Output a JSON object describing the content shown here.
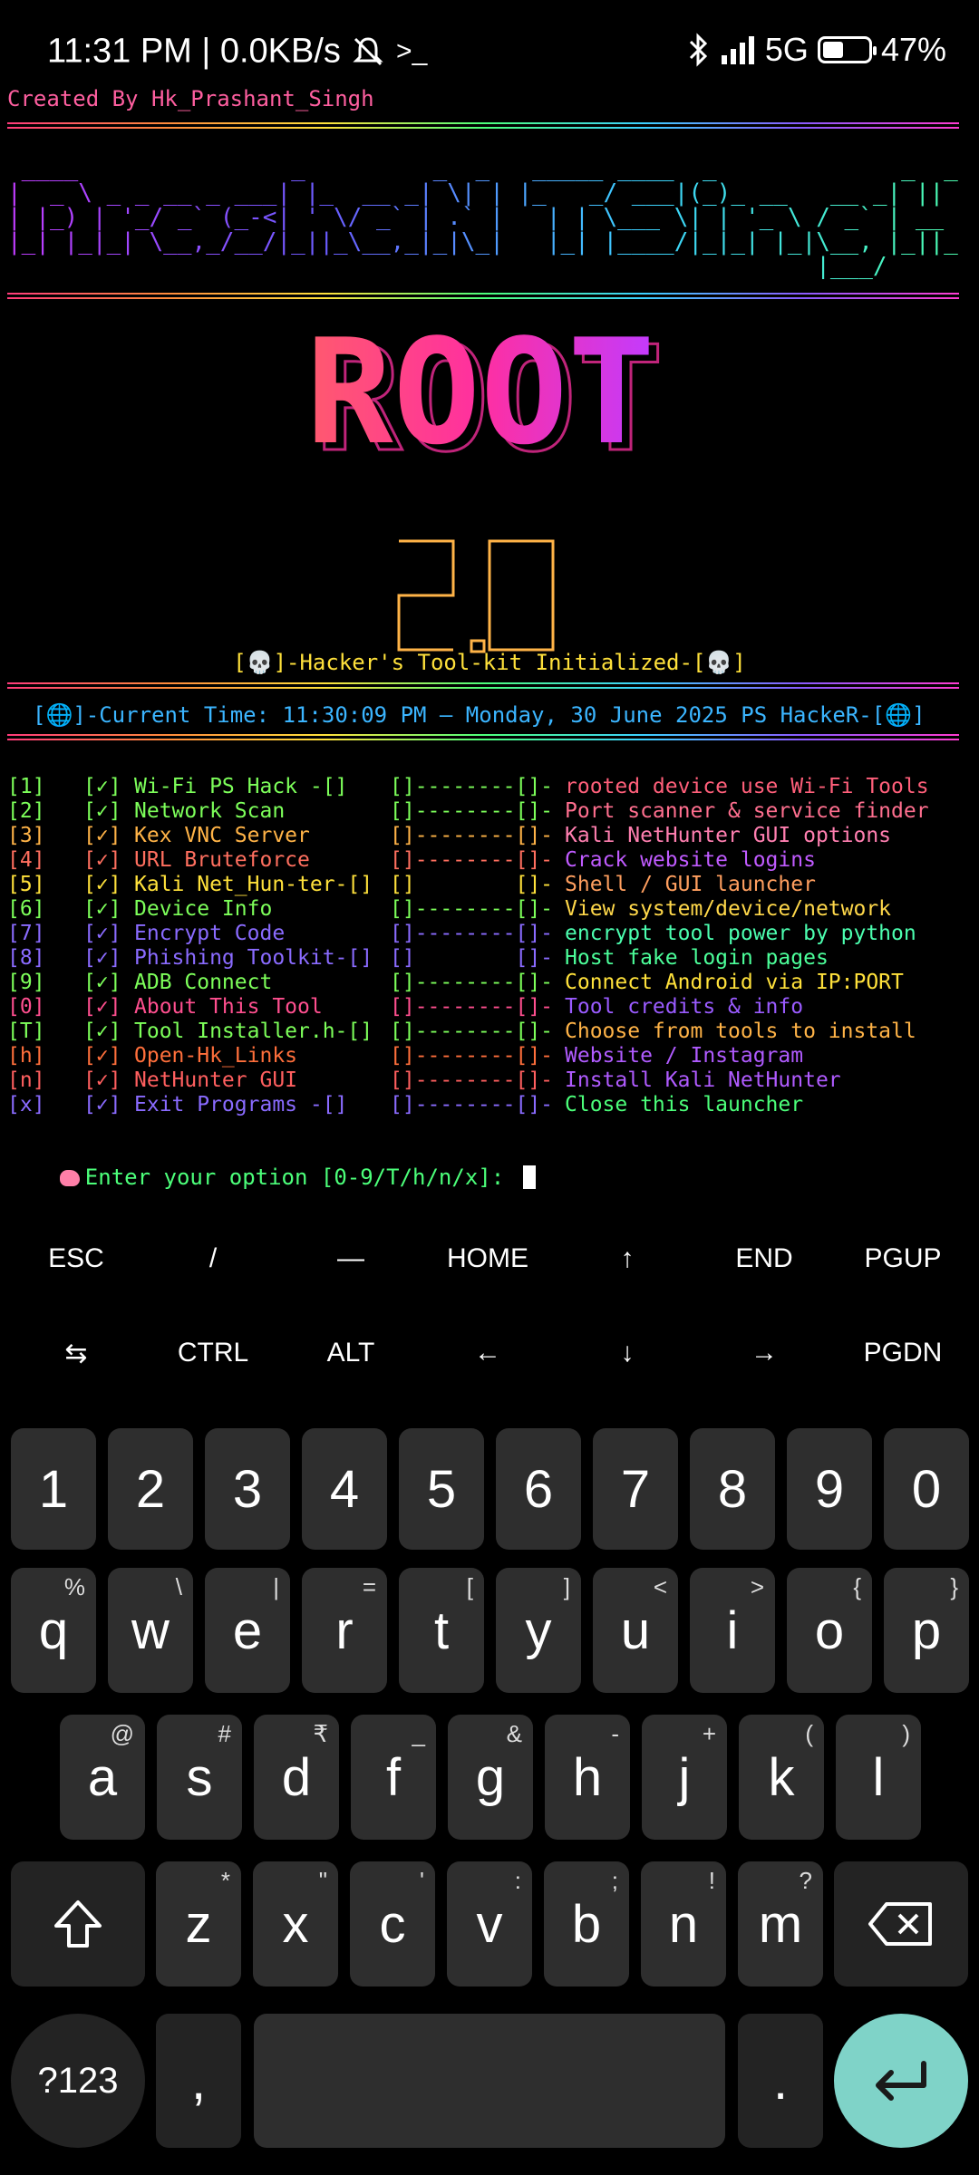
{
  "status": {
    "time": "11:31 PM",
    "speed": "0.0KB/s",
    "network": "5G",
    "battery": "47%",
    "battery_level": 0.47
  },
  "terminal": {
    "credit": "Created By Hk_Prashant_Singh",
    "root_title": "ROOT",
    "init_line": "[💀]-Hacker's Tool-kit Initialized-[💀]",
    "time_line": "[🌐]-Current Time: 11:30:09 PM — Monday, 30 June 2025 PS HackeR-[🌐]",
    "menu": [
      {
        "key": "[1]",
        "check": "[✓]",
        "name": "Wi-Fi PS Hack -[]",
        "dash": "[]--------[]-",
        "desc": "rooted device use Wi-Fi Tools",
        "color": "#7dff5a",
        "desc_color": "#ff5f7a"
      },
      {
        "key": "[2]",
        "check": "[✓]",
        "name": "Network Scan",
        "dash": "[]--------[]-",
        "desc": "Port scanner & service finder",
        "color": "#7dff5a",
        "desc_color": "#ff6f8f"
      },
      {
        "key": "[3]",
        "check": "[✓]",
        "name": "Kex VNC Server",
        "dash": "[]--------[]-",
        "desc": "Kali NetHunter GUI options",
        "color": "#ffb347",
        "desc_color": "#ff7fb0"
      },
      {
        "key": "[4]",
        "check": "[✓]",
        "name": "URL Bruteforce",
        "dash": "[]--------[]-",
        "desc": "Crack website logins",
        "color": "#ff6f5f",
        "desc_color": "#c05bff"
      },
      {
        "key": "[5]",
        "check": "[✓]",
        "name": "Kali Net_Hun-ter-[]",
        "dash": "[]        []-",
        "desc": "Shell / GUI launcher",
        "color": "#ffe13b",
        "desc_color": "#ff9f5f"
      },
      {
        "key": "[6]",
        "check": "[✓]",
        "name": "Device Info",
        "dash": "[]--------[]-",
        "desc": "View system/device/network",
        "color": "#7dff5a",
        "desc_color": "#ffd84a"
      },
      {
        "key": "[7]",
        "check": "[✓]",
        "name": "Encrypt Code",
        "dash": "[]--------[]-",
        "desc": "encrypt tool power by python",
        "color": "#8a6bff",
        "desc_color": "#4cffb0"
      },
      {
        "key": "[8]",
        "check": "[✓]",
        "name": "Phishing Toolkit-[]",
        "dash": "[]        []-",
        "desc": "Host fake login pages",
        "color": "#8a6bff",
        "desc_color": "#4cff9a"
      },
      {
        "key": "[9]",
        "check": "[✓]",
        "name": "ADB Connect",
        "dash": "[]--------[]-",
        "desc": "Connect Android via IP:PORT",
        "color": "#7dff5a",
        "desc_color": "#ffe13b"
      },
      {
        "key": "[0]",
        "check": "[✓]",
        "name": "About This Tool",
        "dash": "[]--------[]-",
        "desc": "Tool credits & info",
        "color": "#ff4f8f",
        "desc_color": "#9a5bff"
      },
      {
        "key": "[T]",
        "check": "[✓]",
        "name": "Tool Installer.h-[]",
        "dash": "[]--------[]-",
        "desc": "Choose from tools to install",
        "color": "#7dff5a",
        "desc_color": "#ffb347"
      },
      {
        "key": "[h]",
        "check": "[✓]",
        "name": "Open-Hk_Links",
        "dash": "[]--------[]-",
        "desc": "Website / Instagram",
        "color": "#ff6f3b",
        "desc_color": "#b05bff"
      },
      {
        "key": "[n]",
        "check": "[✓]",
        "name": "NetHunter GUI",
        "dash": "[]--------[]-",
        "desc": "Install Kali NetHunter",
        "color": "#ff5f5f",
        "desc_color": "#b05bff"
      },
      {
        "key": "[x]",
        "check": "[✓]",
        "name": "Exit Programs -[]",
        "dash": "[]--------[]-",
        "desc": "Close this launcher",
        "color": "#8a6bff",
        "desc_color": "#4cff7a"
      }
    ],
    "prompt": "Enter your option [0-9/T/h/n/x]: "
  },
  "extra_keys": {
    "row1": [
      "ESC",
      "/",
      "—",
      "HOME",
      "↑",
      "END",
      "PGUP"
    ],
    "row2": [
      "⇆",
      "CTRL",
      "ALT",
      "←",
      "↓",
      "→",
      "PGDN"
    ]
  },
  "keyboard": {
    "numbers": [
      "1",
      "2",
      "3",
      "4",
      "5",
      "6",
      "7",
      "8",
      "9",
      "0"
    ],
    "row1": [
      [
        "q",
        "%"
      ],
      [
        "w",
        "\\"
      ],
      [
        "e",
        "|"
      ],
      [
        "r",
        "="
      ],
      [
        "t",
        "["
      ],
      [
        "y",
        "]"
      ],
      [
        "u",
        "<"
      ],
      [
        "i",
        ">"
      ],
      [
        "o",
        "{"
      ],
      [
        "p",
        "}"
      ]
    ],
    "row2": [
      [
        "a",
        "@"
      ],
      [
        "s",
        "#"
      ],
      [
        "d",
        "₹"
      ],
      [
        "f",
        "_"
      ],
      [
        "g",
        "&"
      ],
      [
        "h",
        "-"
      ],
      [
        "j",
        "+"
      ],
      [
        "k",
        "("
      ],
      [
        "l",
        ")"
      ]
    ],
    "row3": [
      [
        "z",
        "*"
      ],
      [
        "x",
        "\""
      ],
      [
        "c",
        "'"
      ],
      [
        "v",
        ":"
      ],
      [
        "b",
        ";"
      ],
      [
        "n",
        "!"
      ],
      [
        "m",
        "?"
      ]
    ],
    "sym_label": "?123",
    "comma": ",",
    "period": "."
  }
}
